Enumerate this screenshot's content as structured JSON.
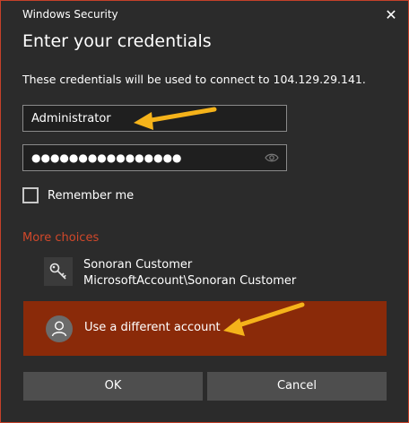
{
  "window": {
    "title": "Windows Security",
    "close_glyph": "✕"
  },
  "heading": "Enter your credentials",
  "description": "These credentials will be used to connect to 104.129.29.141.",
  "username": {
    "value": "Administrator"
  },
  "password": {
    "masked": "●●●●●●●●●●●●●●●●"
  },
  "remember": {
    "label": "Remember me",
    "checked": false
  },
  "more_choices": "More choices",
  "saved_account": {
    "name": "Sonoran Customer",
    "account": "MicrosoftAccount\\Sonoran Customer"
  },
  "different_account": {
    "label": "Use a different account"
  },
  "buttons": {
    "ok": "OK",
    "cancel": "Cancel"
  },
  "colors": {
    "accent": "#8a2a09",
    "link": "#d1482a",
    "annotation": "#f5b31a",
    "background": "#2b2b2b"
  }
}
